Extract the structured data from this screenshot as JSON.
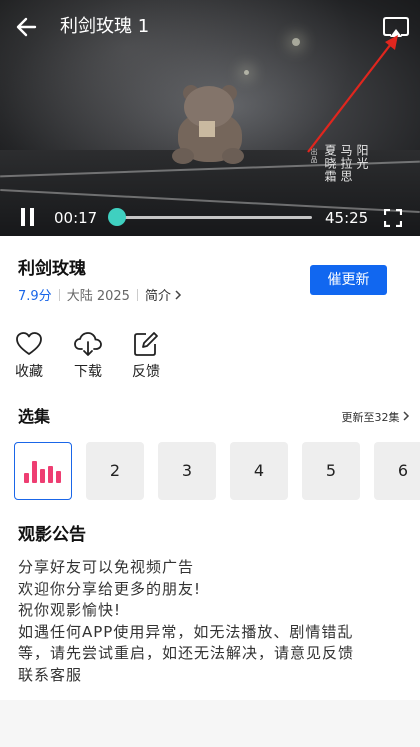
{
  "player": {
    "title": "利剑玫瑰 1",
    "current_time": "00:17",
    "total_time": "45:25",
    "progress": 0.006,
    "overlay_text": [
      "阳光",
      "马拉思",
      "夏晓霜",
      "出品"
    ]
  },
  "show": {
    "title": "利剑玫瑰",
    "score": "7.9分",
    "region": "大陆",
    "year": "2025",
    "intro_label": "简介",
    "urge_button": "催更新"
  },
  "actions": [
    {
      "label": "收藏",
      "icon": "heart-icon"
    },
    {
      "label": "下载",
      "icon": "cloud-download-icon"
    },
    {
      "label": "反馈",
      "icon": "edit-icon"
    }
  ],
  "episodes": {
    "section_title": "选集",
    "update_text": "更新至32集",
    "items": [
      "1",
      "2",
      "3",
      "4",
      "5",
      "6"
    ]
  },
  "notice": {
    "title": "观影公告",
    "lines": [
      "分享好友可以免视频广告",
      "欢迎你分享给更多的朋友!",
      "祝你观影愉快!",
      "如遇任何APP使用异常，如无法播放、剧情错乱",
      "等，请先尝试重启，如还无法解决，请意见反馈",
      "联系客服"
    ]
  },
  "colors": {
    "accent": "#1167f0",
    "progress_thumb": "#3fd0c0",
    "playing_bars": "#ee3e72"
  }
}
